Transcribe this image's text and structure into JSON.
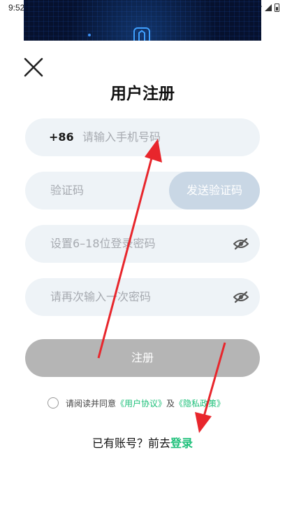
{
  "status_bar": {
    "time": "9:52",
    "icons": [
      "wifi-icon",
      "signal-icon",
      "battery-icon"
    ]
  },
  "header": {
    "close_icon": "close-icon",
    "title": "用户注册"
  },
  "form": {
    "phone": {
      "country_code": "+86",
      "placeholder": "请输入手机号码",
      "value": ""
    },
    "verify_code": {
      "placeholder": "验证码",
      "value": "",
      "send_button_label": "发送验证码"
    },
    "password": {
      "placeholder": "设置6–18位登录密码",
      "value": "",
      "toggle_icon": "eye-hidden-icon"
    },
    "confirm_password": {
      "placeholder": "请再次输入一次密码",
      "value": "",
      "toggle_icon": "eye-hidden-icon"
    },
    "register_button_label": "注册"
  },
  "agreement": {
    "checked": false,
    "prefix": "请阅读并同意",
    "user_agreement_link": "《用户协议》",
    "connector": "及",
    "privacy_policy_link": "《隐私政策》"
  },
  "login_prompt": {
    "text": "已有账号？前去",
    "link": "登录"
  },
  "colors": {
    "accent_green": "#1ec07a",
    "field_background": "#eef3f7",
    "send_button_background": "#c9d7e5",
    "register_button_disabled": "#b5b5b5",
    "annotation_arrow": "#e8262c",
    "banner_background": "#06112e"
  }
}
